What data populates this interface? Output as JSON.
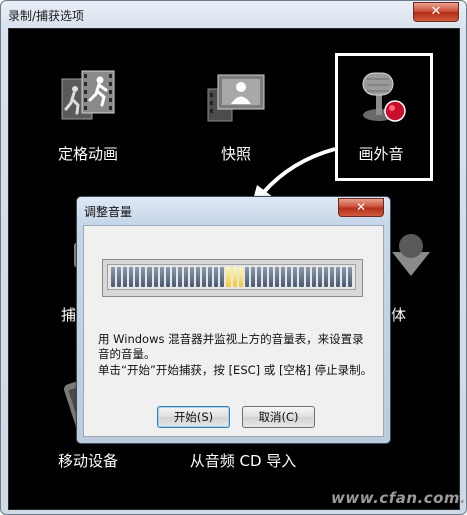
{
  "window": {
    "title": "录制/捕获选项",
    "close_symbol": "✕"
  },
  "options": [
    {
      "label": "定格动画",
      "icon": "film-runner-icon"
    },
    {
      "label": "快照",
      "icon": "snapshot-film-icon"
    },
    {
      "label": "画外音",
      "icon": "microphone-icon",
      "selected": true
    },
    {
      "label": "捕",
      "icon": "camera-icon"
    },
    {
      "label": "体",
      "icon": "media-icon"
    },
    {
      "label": "移动设备",
      "icon": "mobile-device-icon"
    },
    {
      "label": "从音频 CD 导入",
      "icon": "audio-cd-icon"
    }
  ],
  "dialog": {
    "title": "调整音量",
    "close_symbol": "✕",
    "meter": {
      "segments": 40,
      "active_segments": [
        19,
        20,
        21
      ],
      "level": 0.5
    },
    "instruction": "用 Windows 混音器并监视上方的音量表，来设置录音的音量。",
    "hint": "单击“开始”开始捕获，按 [ESC] 或 [空格] 停止录制。",
    "start_label": "开始(S)",
    "cancel_label": "取消(C)"
  },
  "watermark": "www.cfan.com.cn",
  "colors": {
    "background": "#000000",
    "meter_on": "#f0c93a",
    "meter_off": "#5a6a80",
    "close": "#c7482f"
  }
}
